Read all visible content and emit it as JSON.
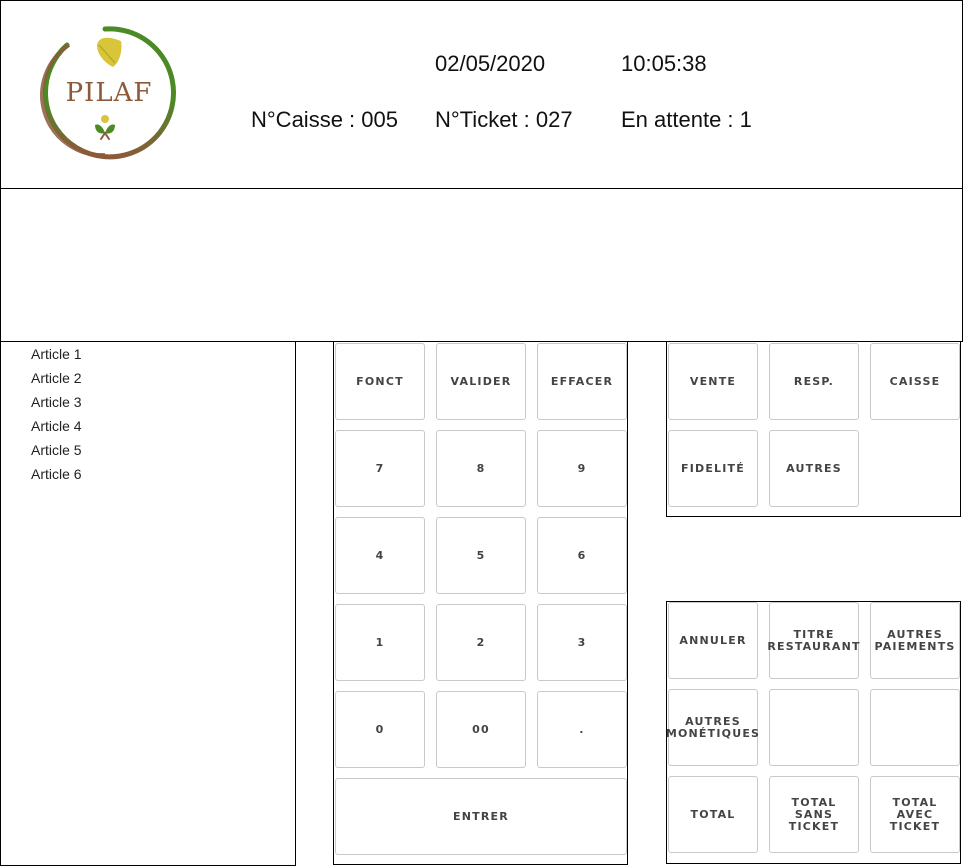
{
  "header": {
    "logo_text": "PILAF",
    "date": "02/05/2020",
    "time": "10:05:38",
    "caisse": "N°Caisse : 005",
    "ticket": "N°Ticket : 027",
    "attente": "En attente : 1"
  },
  "articles": [
    "Article 1",
    "Article 2",
    "Article 3",
    "Article 4",
    "Article 5",
    "Article 6"
  ],
  "keypad": {
    "fonct": "FONCT",
    "valider": "VALIDER",
    "effacer": "EFFACER",
    "k7": "7",
    "k8": "8",
    "k9": "9",
    "k4": "4",
    "k5": "5",
    "k6": "6",
    "k1": "1",
    "k2": "2",
    "k3": "3",
    "k0": "0",
    "k00": "00",
    "dot": ".",
    "entrer": "ENTRER"
  },
  "modes": {
    "vente": "VENTE",
    "resp": "RESP.",
    "caisse": "CAISSE",
    "fidelite": "FIDELITÉ",
    "autres": "AUTRES"
  },
  "payments": {
    "annuler": "ANNULER",
    "titre_restaurant": "TITRE\nRESTAURANT",
    "autres_paiements": "AUTRES\nPAIEMENTS",
    "autres_monetiques": "AUTRES\nMONÉTIQUES",
    "total": "TOTAL",
    "total_sans_ticket": "TOTAL\nSANS TICKET",
    "total_avec_ticket": "TOTAL\nAVEC TICKET"
  },
  "colors": {
    "logo_green": "#4b8a24",
    "logo_brown": "#8a5a3a",
    "leaf_yellow": "#d8c53a"
  }
}
